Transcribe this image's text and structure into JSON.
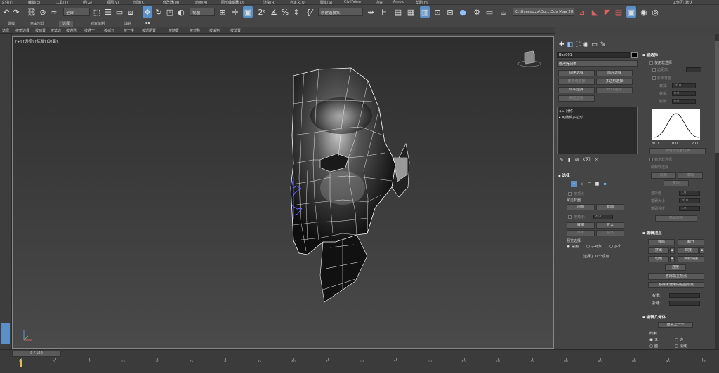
{
  "menubar": {
    "items": [
      "文件(F)",
      "编辑(E)",
      "工具(T)",
      "组(G)",
      "视图(V)",
      "创建(C)",
      "修改器(M)",
      "动画(A)",
      "图形编辑器(D)",
      "渲染(R)",
      "自定义(U)",
      "脚本(S)",
      "Civil View",
      "内容",
      "Arnold",
      "帮助(H)"
    ],
    "workspace": "工作区: 默认"
  },
  "toolbar": {
    "selection_filter": "全部",
    "coord_system": "视图",
    "named_selection": "创建选择集",
    "project_path": "C:\\Users\\zzx\\Do…\\3ds Max 2020"
  },
  "ribbon": {
    "tabs": [
      "建模",
      "自由形式",
      "选择",
      "对象绘制",
      "填充",
      "▪▪"
    ]
  },
  "subribbon": {
    "items": [
      "选择",
      "按值选择",
      "按面置",
      "按法选",
      "按通选",
      "按通一",
      "按孤元",
      "按一半",
      "按透距置",
      "按随置",
      "按对称",
      "按填色",
      "按法置"
    ]
  },
  "viewport": {
    "label": "[+] [透视] [标准] [边面]"
  },
  "command_panel": {
    "object_name": "Box001",
    "modifier_list": "修改器列表",
    "buttons": [
      "网格选择",
      "面片选择",
      "样条线选择",
      "多边形选择",
      "体积选择",
      "FFD 选择",
      "曲面选择"
    ],
    "stack": [
      "可编辑多边形",
      "可编辑多边形"
    ],
    "stack_top": "对称"
  },
  "selection_rollout": {
    "title": "选择",
    "by_vertex": "按顶点",
    "ignore_back": "忽略背面",
    "by_angle": "按角度:",
    "angle_val": "45.0",
    "shrink": "收缩",
    "grow": "扩大",
    "ring": "环形",
    "loop": "循环",
    "preview_title": "预览选择",
    "disabled": "禁用",
    "subobject": "子对象",
    "multi": "多个",
    "status": "选择了 0 个顶点",
    "visible_label": "可见背面",
    "outline": "轮廓",
    "front": "前面"
  },
  "soft_selection": {
    "title": "软选择",
    "use_soft": "使用软选择",
    "edge_dist": "边距离:",
    "affect_back": "影响背面",
    "falloff": "衰减:",
    "falloff_val": "20.0",
    "pinch": "收缩:",
    "pinch_val": "0.0",
    "bubble": "膨胀:",
    "bubble_val": "0.0",
    "curve_left": "20.0",
    "curve_mid": "0.0",
    "curve_right": "20.0",
    "shade_face": "明暗处理面切换",
    "lock_soft": "锁定软选择",
    "paint_title": "绘制软选择",
    "paint": "绘制",
    "blur": "模糊",
    "revert": "复原",
    "sel_value": "选择值",
    "sel_value_val": "1.0",
    "brush_size": "笔刷大小",
    "brush_size_val": "20.0",
    "brush_strength": "笔刷强度",
    "brush_strength_val": "1.0",
    "brush_options": "笔刷选项"
  },
  "edit_vertices": {
    "title": "编辑顶点",
    "remove": "移除",
    "break": "断开",
    "extrude": "挤出",
    "weld": "焊接",
    "chamfer": "切角",
    "target_weld": "目标焊接",
    "connect": "连接",
    "remove_iso": "移除孤立顶点",
    "remove_unused": "移除未使用的贴图顶点",
    "weight": "权重:",
    "crease": "折缝:"
  },
  "edit_geometry": {
    "title": "编辑几何体",
    "repeat_last": "重复上一个",
    "constraints": "约束",
    "none": "无",
    "edge": "边",
    "face": "面",
    "normal": "法线"
  },
  "timeline": {
    "frame": "0 / 100",
    "ticks": [
      "0",
      "5",
      "10",
      "15",
      "20",
      "25",
      "30",
      "35",
      "40",
      "45",
      "50",
      "55",
      "60",
      "65",
      "70",
      "75",
      "80",
      "85",
      "90",
      "95",
      "100"
    ]
  },
  "colors": {
    "accent": "#5b8fc6",
    "panel": "#454545",
    "viewport_top": "#2e2e2e",
    "viewport_bottom": "#4a4a4a",
    "wire": "#ffffff",
    "selected_wire": "#6a6aff"
  }
}
